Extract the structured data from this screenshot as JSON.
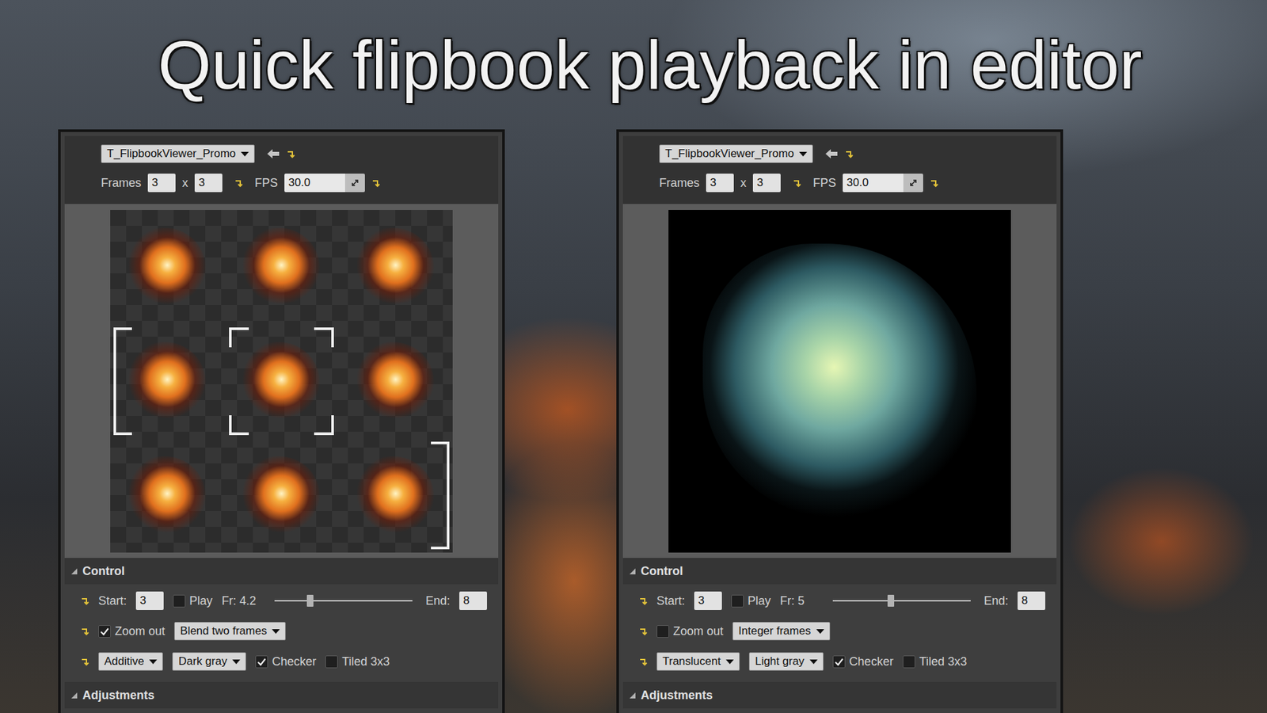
{
  "title": "Quick flipbook playback in editor",
  "panels": [
    {
      "asset": "T_FlipbookViewer_Promo",
      "frames_label": "Frames",
      "frames_x": "3",
      "times": "x",
      "frames_y": "3",
      "fps_label": "FPS",
      "fps": "30.0",
      "color": "#e0701e",
      "cells": [
        {
          "mark": "none"
        },
        {
          "mark": "none"
        },
        {
          "mark": "none"
        },
        {
          "mark": "start"
        },
        {
          "mark": "current"
        },
        {
          "mark": "none"
        },
        {
          "mark": "none"
        },
        {
          "mark": "none"
        },
        {
          "mark": "end"
        }
      ],
      "control": {
        "header": "Control",
        "expanded": true,
        "start_label": "Start:",
        "start": "3",
        "play": {
          "label": "Play",
          "checked": false
        },
        "frame_reading": "Fr: 4.2",
        "level": 0.26,
        "end_label": "End:",
        "end": "8",
        "zoom_out": {
          "label": "Zoom out",
          "checked": true
        },
        "blend": "Blend two frames",
        "mode": "Additive",
        "background": "Dark gray",
        "checker": {
          "label": "Checker",
          "checked": true
        },
        "tiled": {
          "label": "Tiled 3x3",
          "checked": false
        }
      },
      "adjustments": {
        "header": "Adjustments",
        "expanded": true
      }
    },
    {
      "asset": "T_FlipbookViewer_Promo",
      "frames_label": "Frames",
      "frames_x": "3",
      "times": "x",
      "frames_y": "3",
      "fps_label": "FPS",
      "fps": "30.0",
      "color": "#6fa8a0",
      "cells": [],
      "control": {
        "header": "Control",
        "expanded": true,
        "start_label": "Start:",
        "start": "3",
        "play": {
          "label": "Play",
          "checked": false
        },
        "frame_reading": "Fr: 5",
        "level": 0.42,
        "end_label": "End:",
        "end": "8",
        "zoom_out": {
          "label": "Zoom out",
          "checked": false
        },
        "blend": "Integer frames",
        "mode": "Translucent",
        "background": "Light gray",
        "checker": {
          "label": "Checker",
          "checked": true
        },
        "tiled": {
          "label": "Tiled 3x3",
          "checked": false
        }
      },
      "adjustments": {
        "header": "Adjustments",
        "expanded": true
      }
    }
  ]
}
